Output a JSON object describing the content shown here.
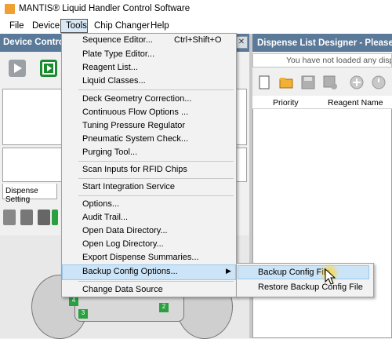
{
  "window": {
    "title": "MANTIS® Liquid Handler Control Software"
  },
  "menubar": {
    "items": [
      "File",
      "Device",
      "Tools",
      "Chip Changer",
      "Help"
    ]
  },
  "left_panel": {
    "title": "Device Control",
    "tab_label": "Dispense Setting"
  },
  "right_panel": {
    "title": "Dispense List Designer - Please crea",
    "notice": "You have not loaded any dispense li",
    "columns": [
      "Priority",
      "Reagent Name"
    ]
  },
  "tools_menu": {
    "items": [
      {
        "label": "Sequence Editor...",
        "shortcut": "Ctrl+Shift+O"
      },
      {
        "label": "Plate Type Editor...",
        "shortcut": ""
      },
      {
        "label": "Reagent List...",
        "shortcut": ""
      },
      {
        "label": "Liquid Classes...",
        "shortcut": ""
      },
      {
        "label": "Deck Geometry Correction...",
        "shortcut": ""
      },
      {
        "label": "Continuous Flow Options ...",
        "shortcut": ""
      },
      {
        "label": "Tuning Pressure Regulator",
        "shortcut": ""
      },
      {
        "label": "Pneumatic System Check...",
        "shortcut": ""
      },
      {
        "label": "Purging Tool...",
        "shortcut": ""
      },
      {
        "label": "Scan Inputs for RFID Chips",
        "shortcut": ""
      },
      {
        "label": "Start Integration Service",
        "shortcut": ""
      },
      {
        "label": "Options...",
        "shortcut": ""
      },
      {
        "label": "Audit Trail...",
        "shortcut": ""
      },
      {
        "label": "Open Data Directory...",
        "shortcut": ""
      },
      {
        "label": "Open Log Directory...",
        "shortcut": ""
      },
      {
        "label": "Export Dispense Summaries...",
        "shortcut": ""
      },
      {
        "label": "Backup Config Options...",
        "shortcut": ""
      },
      {
        "label": "Change Data Source",
        "shortcut": ""
      }
    ]
  },
  "submenu": {
    "items": [
      "Backup Config File",
      "Restore Backup Config File"
    ]
  },
  "deck_labels": [
    "4",
    "3",
    "2"
  ],
  "colors": {
    "header_bg": "#5b7a9a",
    "highlight": "#cce4f7",
    "accent_green": "#1a8c2f"
  }
}
